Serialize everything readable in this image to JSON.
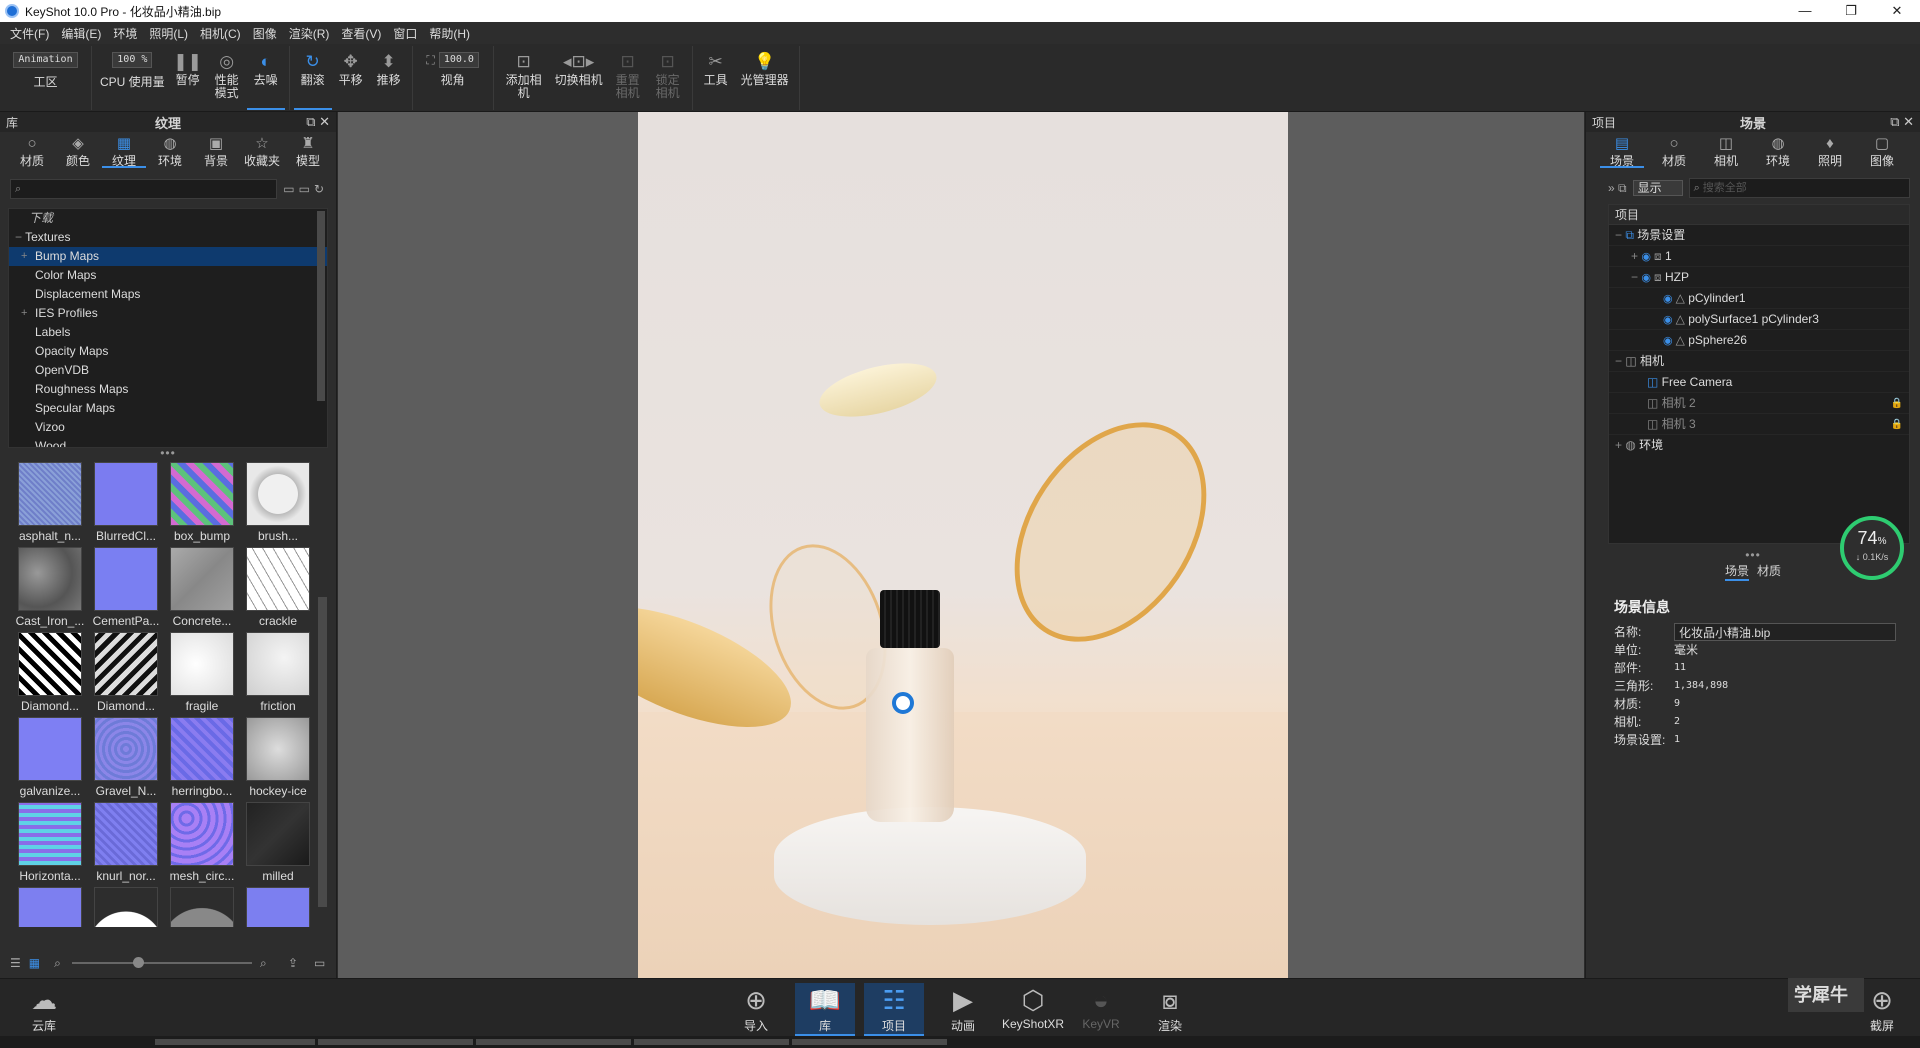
{
  "window": {
    "title": "KeyShot 10.0 Pro  - 化妆品小精油.bip"
  },
  "menu": [
    "文件(F)",
    "编辑(E)",
    "环境",
    "照明(L)",
    "相机(C)",
    "图像",
    "渲染(R)",
    "查看(V)",
    "窗口",
    "帮助(H)"
  ],
  "toolbar": {
    "mode_select": "Animation",
    "cpu_select": "100 %",
    "fov_value": "100.0",
    "workspace": "工区",
    "cpu": "CPU 使用量",
    "pause": "暂停",
    "perf": "性能模式",
    "denoise": "去噪",
    "tumble": "翻滚",
    "pan": "平移",
    "dolly": "推移",
    "view": "视角",
    "add_camera": "添加相机",
    "switch_camera": "切换相机",
    "reset_camera": "重置相机",
    "lock_camera": "锁定相机",
    "tools": "工具",
    "light_manager": "光管理器"
  },
  "library": {
    "left_title": "库",
    "title": "纹理",
    "tabs": [
      "材质",
      "颜色",
      "纹理",
      "环境",
      "背景",
      "收藏夹",
      "模型"
    ],
    "tree_header": "下载",
    "tree_root": "Textures",
    "tree_items": [
      "Bump Maps",
      "Color Maps",
      "Displacement Maps",
      "IES Profiles",
      "Labels",
      "Opacity Maps",
      "OpenVDB",
      "Roughness Maps",
      "Specular Maps",
      "Vizoo",
      "Wood"
    ],
    "thumbs": [
      "asphalt_n...",
      "BlurredCl...",
      "box_bump",
      "brush...",
      "Cast_Iron_...",
      "CementPa...",
      "Concrete...",
      "crackle",
      "Diamond...",
      "Diamond...",
      "fragile",
      "friction",
      "galvanize...",
      "Gravel_N...",
      "herringbo...",
      "hockey-ice",
      "Horizonta...",
      "knurl_nor...",
      "mesh_circ...",
      "milled",
      "",
      "",
      "",
      ""
    ]
  },
  "project": {
    "left_title": "项目",
    "title": "场景",
    "tabs": [
      "场景",
      "材质",
      "相机",
      "环境",
      "照明",
      "图像"
    ],
    "show_select": "显示",
    "search_placeholder": "搜索全部",
    "column": "项目",
    "rows": {
      "scene_set": "场景设置",
      "one": "1",
      "hzp": "HZP",
      "pcyl": "pCylinder1",
      "poly": "polySurface1 pCylinder3",
      "psphere": "pSphere26",
      "camera": "相机",
      "free_cam": "Free Camera",
      "cam2": "相机 2",
      "cam3": "相机 3",
      "env": "环境"
    },
    "subtabs": [
      "场景",
      "材质"
    ],
    "info": {
      "title": "场景信息",
      "name_label": "名称:",
      "name": "化妆品小精油.bip",
      "unit_label": "单位:",
      "unit": "毫米",
      "parts_label": "部件:",
      "parts": "11",
      "tri_label": "三角形:",
      "tri": "1,384,898",
      "mat_label": "材质:",
      "mat": "9",
      "cam_label": "相机:",
      "cam": "2",
      "set_label": "场景设置:",
      "set": "1"
    }
  },
  "gauge": {
    "percent": "74",
    "unit": "%",
    "speed": "↓ 0.1K/s"
  },
  "bottom": {
    "cloud": "云库",
    "import": "导入",
    "library": "库",
    "project": "项目",
    "animation": "动画",
    "keyshotxr": "KeyShotXR",
    "keyvr": "KeyVR",
    "render": "渲染",
    "screenshot": "截屏"
  },
  "watermark": "学犀牛",
  "colors": {
    "accent": "#3b8fe8",
    "selection": "#0e3a6e",
    "gauge": "#2ecc71"
  }
}
